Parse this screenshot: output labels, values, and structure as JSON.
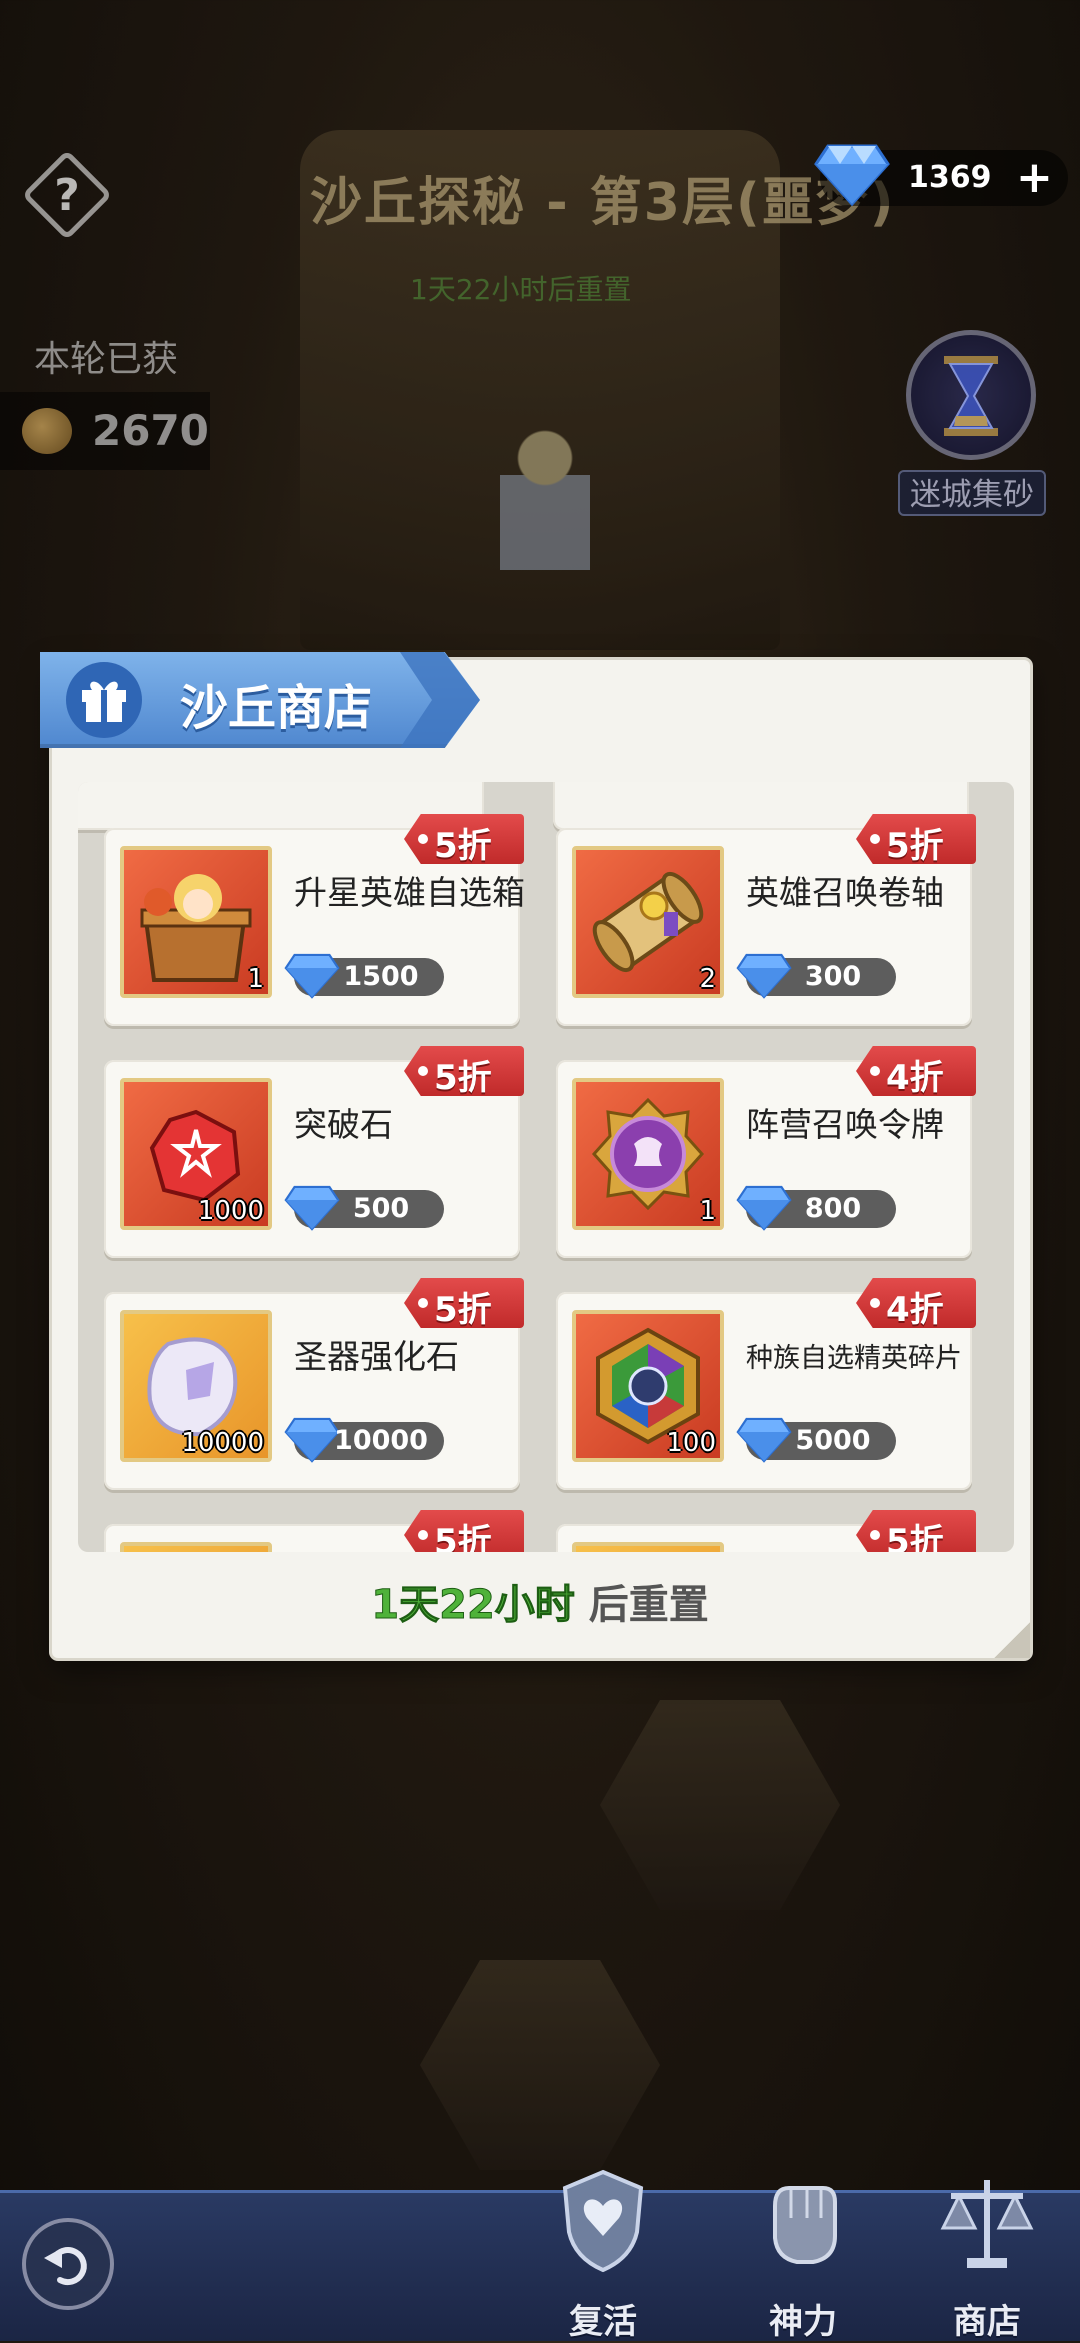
{
  "hud": {
    "help_symbol": "?",
    "stage_title": "沙丘探秘 - 第3层(噩梦)",
    "stage_reset": "1天22小时后重置",
    "gems": "1369",
    "add_symbol": "+",
    "round_label": "本轮已获",
    "coins": "2670",
    "sand_button_label": "迷城集砂"
  },
  "shop": {
    "title": "沙丘商店",
    "reset_time": "1天22小时",
    "reset_suffix": "后重置",
    "items": [
      {
        "name": "升星英雄自选箱",
        "qty": "1",
        "price": "1500",
        "discount": "5折",
        "icon": "hero-chest-icon",
        "bg": "red"
      },
      {
        "name": "英雄召唤卷轴",
        "qty": "2",
        "price": "300",
        "discount": "5折",
        "icon": "scroll-icon",
        "bg": "red"
      },
      {
        "name": "突破石",
        "qty": "1000",
        "price": "500",
        "discount": "5折",
        "icon": "breakthrough-stone-icon",
        "bg": "red"
      },
      {
        "name": "阵营召唤令牌",
        "qty": "1",
        "price": "800",
        "discount": "4折",
        "icon": "faction-token-icon",
        "bg": "red"
      },
      {
        "name": "圣器强化石",
        "qty": "10000",
        "price": "10000",
        "discount": "5折",
        "icon": "artifact-stone-icon",
        "bg": "gold"
      },
      {
        "name": "种族自选精英碎片",
        "qty": "100",
        "price": "5000",
        "discount": "4折",
        "icon": "elite-shard-icon",
        "bg": "red"
      },
      {
        "name": "",
        "qty": "",
        "price": "",
        "discount": "5折",
        "icon": "",
        "bg": "gold"
      },
      {
        "name": "",
        "qty": "",
        "price": "",
        "discount": "5折",
        "icon": "",
        "bg": "gold"
      }
    ]
  },
  "nav": {
    "revive": "复活",
    "power": "神力",
    "shop": "商店"
  },
  "colors": {
    "discount_tag": "#d63a3a",
    "ribbon_blue": "#5b93d8",
    "timer_green": "#4fb23a"
  }
}
